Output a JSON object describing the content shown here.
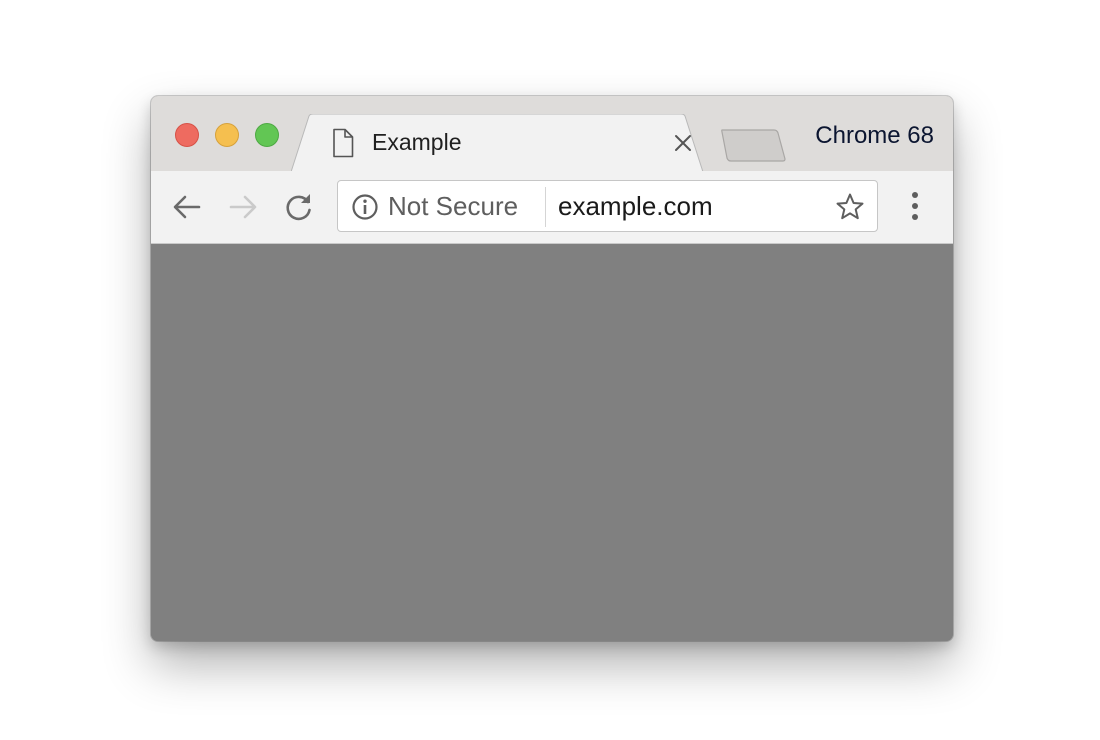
{
  "window": {
    "traffic_lights": {
      "close_color": "#ee6b60",
      "minimize_color": "#f5bf4f",
      "maximize_color": "#62c654"
    }
  },
  "tab": {
    "title": "Example",
    "icon": "document-icon",
    "close_icon": "close-icon"
  },
  "new_tab": {
    "icon": "new-tab-icon"
  },
  "profile_label": "Chrome 68",
  "toolbar": {
    "back_icon": "arrow-left-icon",
    "forward_icon": "arrow-right-icon",
    "reload_icon": "reload-icon",
    "menu_icon": "more-vertical-icon"
  },
  "omnibox": {
    "security_icon": "info-icon",
    "security_label": "Not Secure",
    "url": "example.com",
    "bookmark_icon": "star-icon"
  },
  "colors": {
    "titlebar": "#dedcda",
    "toolbar": "#f2f2f2",
    "content": "#808080"
  }
}
